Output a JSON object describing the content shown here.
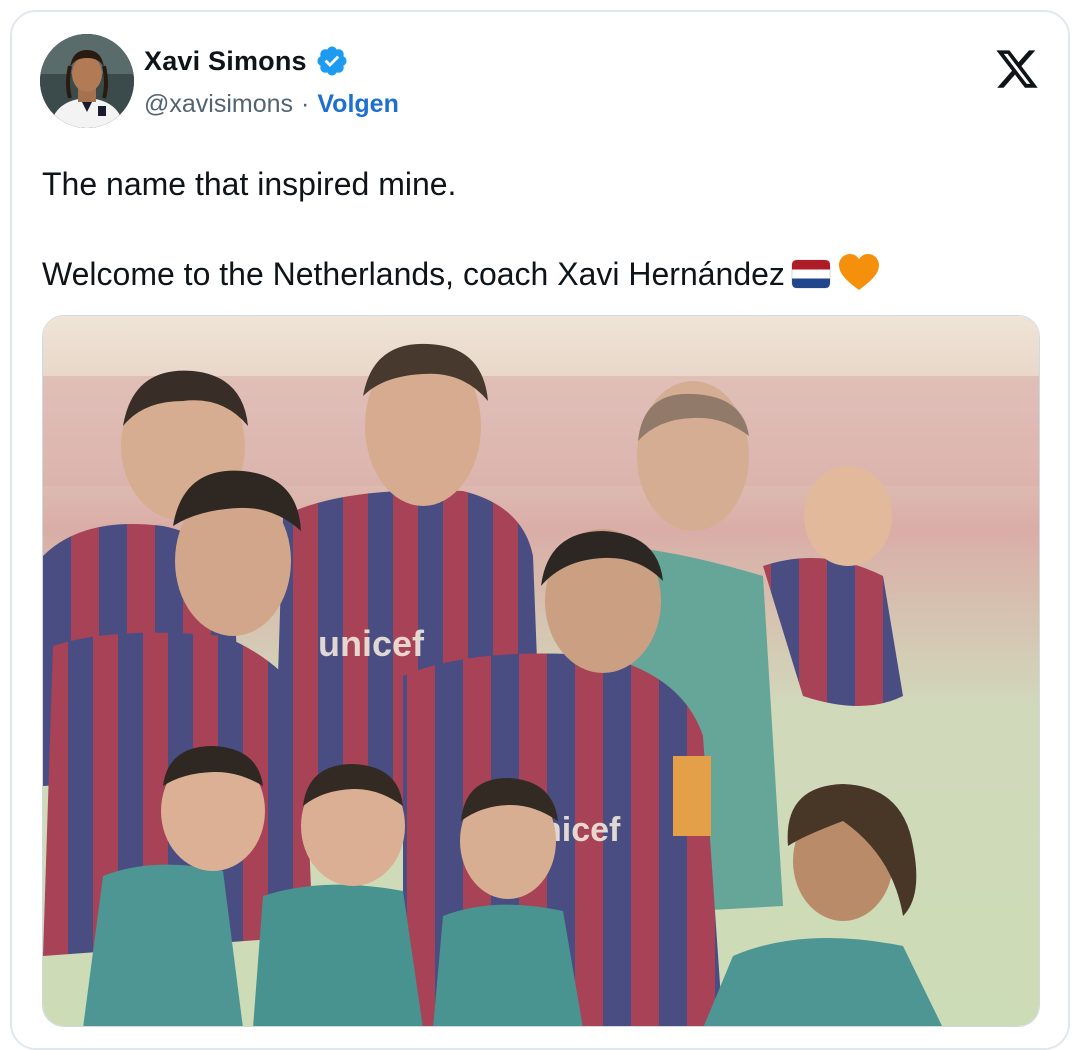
{
  "author": {
    "display_name": "Xavi Simons",
    "handle": "@xavisimons",
    "separator": "·",
    "follow_label": "Volgen",
    "verified": true,
    "avatar_icon": "profile-photo"
  },
  "brand": {
    "logo": "x-logo-icon"
  },
  "tweet": {
    "line1": "The name that inspired mine.",
    "line2": "Welcome to the Netherlands, coach Xavi Hernández",
    "emojis": [
      "flag-netherlands-icon",
      "orange-heart-icon"
    ]
  },
  "media": {
    "kind": "photo",
    "sponsor_text": "unicef",
    "shirt_text_partial": "nicef"
  },
  "colors": {
    "link": "#1d6fd0",
    "verified": "#1d9bf0",
    "secondary_text": "#536471",
    "orange": "#f4900c"
  }
}
